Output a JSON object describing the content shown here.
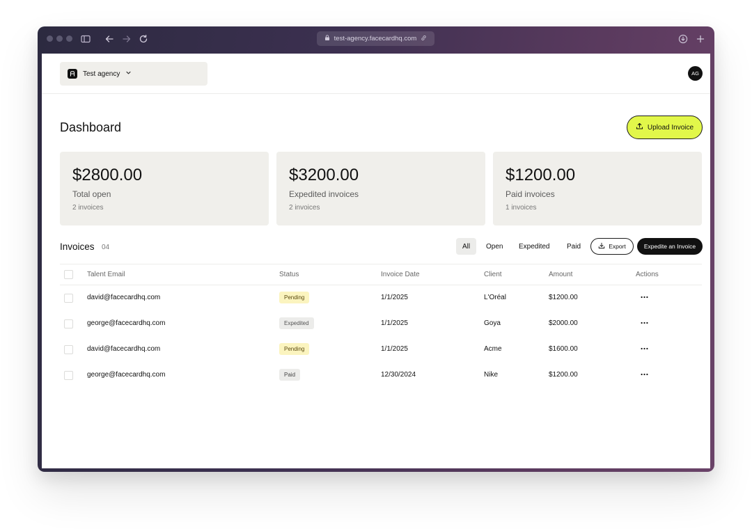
{
  "browser": {
    "url": "test-agency.facecardhq.com"
  },
  "header": {
    "agency_name": "Test agency",
    "avatar_initials": "AG"
  },
  "page": {
    "title": "Dashboard",
    "upload_label": "Upload Invoice"
  },
  "stats": [
    {
      "value": "$2800.00",
      "label": "Total open",
      "count": "2 invoices"
    },
    {
      "value": "$3200.00",
      "label": "Expedited invoices",
      "count": "2 invoices"
    },
    {
      "value": "$1200.00",
      "label": "Paid invoices",
      "count": "1 invoices"
    }
  ],
  "invoices": {
    "title": "Invoices",
    "count": "04",
    "filters": [
      "All",
      "Open",
      "Expedited",
      "Paid"
    ],
    "active_filter": "All",
    "export_label": "Export",
    "expedite_label": "Expedite an Invoice",
    "columns": [
      "Talent Email",
      "Status",
      "Invoice Date",
      "Client",
      "Amount",
      "Actions"
    ],
    "rows": [
      {
        "email": "david@facecardhq.com",
        "status": "Pending",
        "date": "1/1/2025",
        "client": "L'Oréal",
        "amount": "$1200.00"
      },
      {
        "email": "george@facecardhq.com",
        "status": "Expedited",
        "date": "1/1/2025",
        "client": "Goya",
        "amount": "$2000.00"
      },
      {
        "email": "david@facecardhq.com",
        "status": "Pending",
        "date": "1/1/2025",
        "client": "Acme",
        "amount": "$1600.00"
      },
      {
        "email": "george@facecardhq.com",
        "status": "Paid",
        "date": "12/30/2024",
        "client": "Nike",
        "amount": "$1200.00"
      }
    ]
  },
  "colors": {
    "accent": "#e2f74a",
    "card_bg": "#f0efeb",
    "pending_badge": "#fbf4bf",
    "neutral_badge": "#ececea",
    "primary_dark": "#111111"
  }
}
